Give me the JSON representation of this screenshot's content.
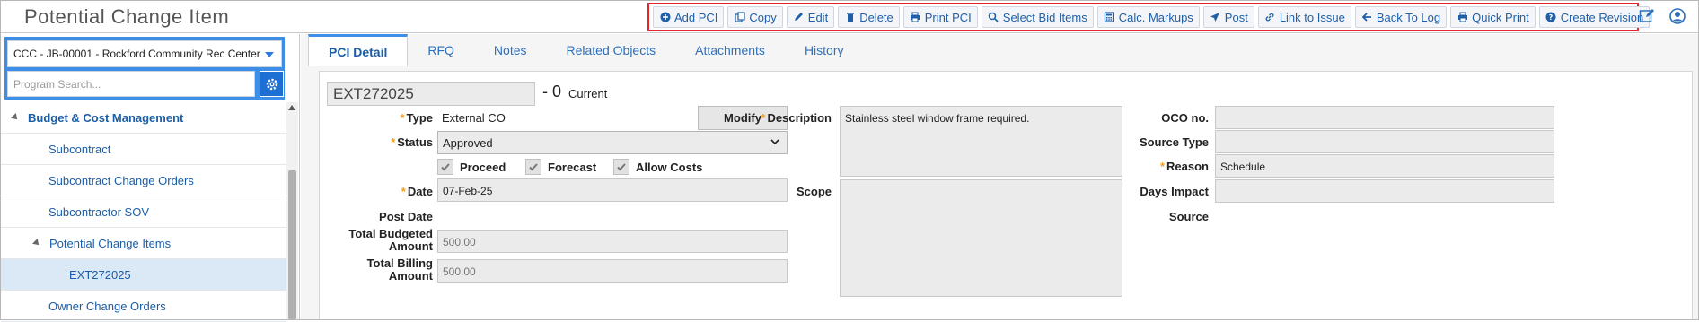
{
  "window": {
    "title": "Potential Change Item"
  },
  "toolbar": {
    "buttons": [
      {
        "label": "Add PCI",
        "icon": "plus-circle-icon"
      },
      {
        "label": "Copy",
        "icon": "copy-icon"
      },
      {
        "label": "Edit",
        "icon": "pencil-icon"
      },
      {
        "label": "Delete",
        "icon": "trash-icon"
      },
      {
        "label": "Print PCI",
        "icon": "printer-icon"
      },
      {
        "label": "Select Bid Items",
        "icon": "search-icon"
      },
      {
        "label": "Calc. Markups",
        "icon": "calculator-icon"
      },
      {
        "label": "Post",
        "icon": "paper-plane-icon"
      },
      {
        "label": "Link to Issue",
        "icon": "link-icon"
      },
      {
        "label": "Back To Log",
        "icon": "arrow-left-icon"
      },
      {
        "label": "Quick Print",
        "icon": "printer-icon"
      },
      {
        "label": "Create Revision",
        "icon": "question-circle-icon"
      }
    ],
    "highlight_color": "#e0262a"
  },
  "sidebar": {
    "project": "CCC - JB-00001 - Rockford Community Rec Center",
    "search_placeholder": "Program Search...",
    "tree": [
      {
        "label": "Budget & Cost Management",
        "level": 0,
        "group": true
      },
      {
        "label": "Subcontract",
        "level": 1
      },
      {
        "label": "Subcontract Change Orders",
        "level": 1
      },
      {
        "label": "Subcontractor SOV",
        "level": 1
      },
      {
        "label": "Potential Change Items",
        "level": 1,
        "expanded": true
      },
      {
        "label": "EXT272025",
        "level": 2,
        "selected": true
      },
      {
        "label": "Owner Change Orders",
        "level": 1
      }
    ]
  },
  "tabs": [
    {
      "label": "PCI Detail",
      "active": true
    },
    {
      "label": "RFQ"
    },
    {
      "label": "Notes"
    },
    {
      "label": "Related Objects"
    },
    {
      "label": "Attachments"
    },
    {
      "label": "History"
    }
  ],
  "form": {
    "pci_number": "EXT272025",
    "revision": "- 0",
    "revision_status": "Current",
    "type_label": "Type",
    "type_value": "External CO",
    "modify_label": "Modify",
    "status_label": "Status",
    "status_value": "Approved",
    "checkboxes": [
      {
        "label": "Proceed",
        "checked": true
      },
      {
        "label": "Forecast",
        "checked": true
      },
      {
        "label": "Allow Costs",
        "checked": true
      }
    ],
    "date_label": "Date",
    "date_value": "07-Feb-25",
    "post_date_label": "Post Date",
    "total_budgeted_label_1": "Total Budgeted",
    "total_budgeted_label_2": "Amount",
    "total_budgeted_value": "500.00",
    "total_billing_label_1": "Total Billing",
    "total_billing_label_2": "Amount",
    "total_billing_value": "500.00",
    "description_label": "Description",
    "description_value": "Stainless steel window frame required.",
    "scope_label": "Scope",
    "scope_value": "",
    "oco_label": "OCO no.",
    "oco_value": "",
    "source_type_label": "Source Type",
    "source_type_value": "",
    "reason_label": "Reason",
    "reason_value": "Schedule",
    "days_impact_label": "Days Impact",
    "days_impact_value": "",
    "source_label": "Source"
  },
  "colors": {
    "accent": "#3d8ee8",
    "link": "#1a5ea8",
    "required": "#f0a020"
  }
}
